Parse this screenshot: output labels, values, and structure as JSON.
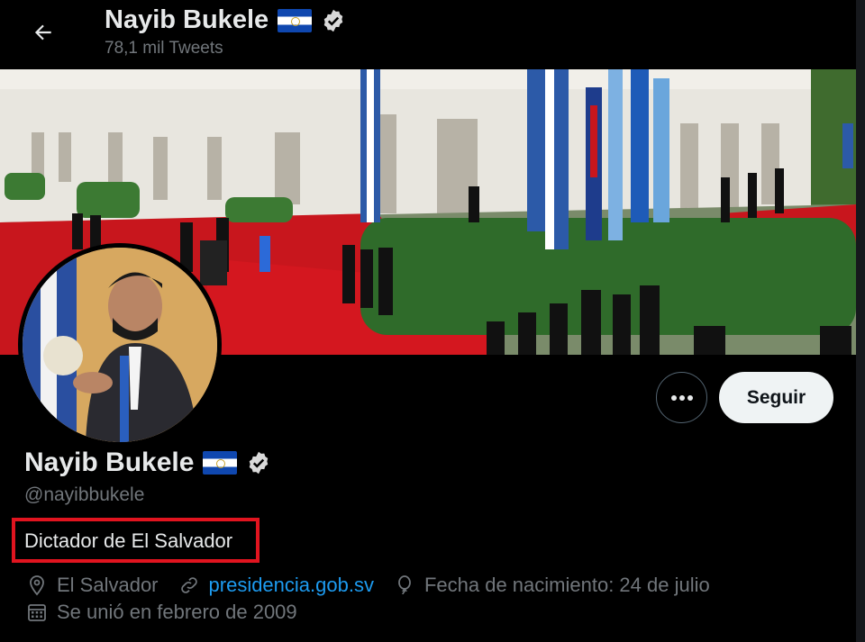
{
  "header": {
    "back_label": "back",
    "name": "Nayib Bukele",
    "tweet_count": "78,1 mil Tweets"
  },
  "profile": {
    "display_name": "Nayib Bukele",
    "handle": "@nayibbukele",
    "bio": "Dictador de El Salvador",
    "location": "El Salvador",
    "website": "presidencia.gob.sv",
    "birthday": "Fecha de nacimiento: 24 de julio",
    "joined": "Se unió en febrero de 2009"
  },
  "actions": {
    "follow_label": "Seguir",
    "more_label": "•••"
  },
  "icons": {
    "back": "arrow-left-icon",
    "verified": "verified-badge-icon",
    "flag": "el-salvador-flag-icon",
    "location": "location-pin-icon",
    "link": "link-icon",
    "birthday": "balloon-icon",
    "calendar": "calendar-icon"
  },
  "colors": {
    "background": "#000000",
    "text_primary": "#e7e9ea",
    "text_secondary": "#71767b",
    "link": "#1d9bf0",
    "highlight_box": "#e1141f",
    "follow_bg": "#eff3f4"
  }
}
